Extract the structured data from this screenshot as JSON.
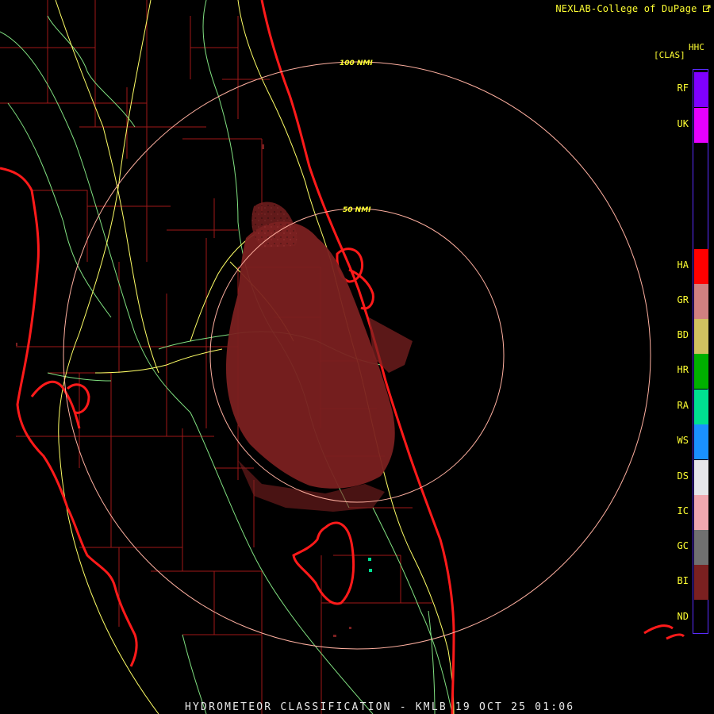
{
  "header": {
    "credit": "NEXLAB-College of DuPage",
    "credit_icon": "external-link-icon"
  },
  "product": {
    "code": "HHC",
    "abbr": "[CLAS]",
    "title": "HYDROMETEOR CLASSIFICATION - KMLB 19 OCT 25 01:06"
  },
  "range_rings": [
    {
      "label": "50 NMI",
      "radius_nmi": 50
    },
    {
      "label": "100 NMI",
      "radius_nmi": 100
    }
  ],
  "legend": {
    "items": [
      {
        "code": "RF",
        "color": "#7f00ff"
      },
      {
        "code": "UK",
        "color": "#e600ff"
      },
      {
        "code": "HA",
        "color": "#ff0000"
      },
      {
        "code": "GR",
        "color": "#d08080"
      },
      {
        "code": "BD",
        "color": "#d0c060"
      },
      {
        "code": "HR",
        "color": "#00b000"
      },
      {
        "code": "RA",
        "color": "#00e090"
      },
      {
        "code": "WS",
        "color": "#1a90ff"
      },
      {
        "code": "DS",
        "color": "#e6e6ea"
      },
      {
        "code": "IC",
        "color": "#f0a8b0"
      },
      {
        "code": "GC",
        "color": "#707070"
      },
      {
        "code": "BI",
        "color": "#7a2020"
      },
      {
        "code": "ND",
        "color": "#000000"
      }
    ]
  },
  "colors": {
    "coastline": "#ff1a1a",
    "county_lines": "#a01818",
    "highways": "#ffff66",
    "roads": "#80e080",
    "range_ring": "#ffb0a0",
    "biological_echo": "#7a2020",
    "rain_echo": "#00e090"
  }
}
